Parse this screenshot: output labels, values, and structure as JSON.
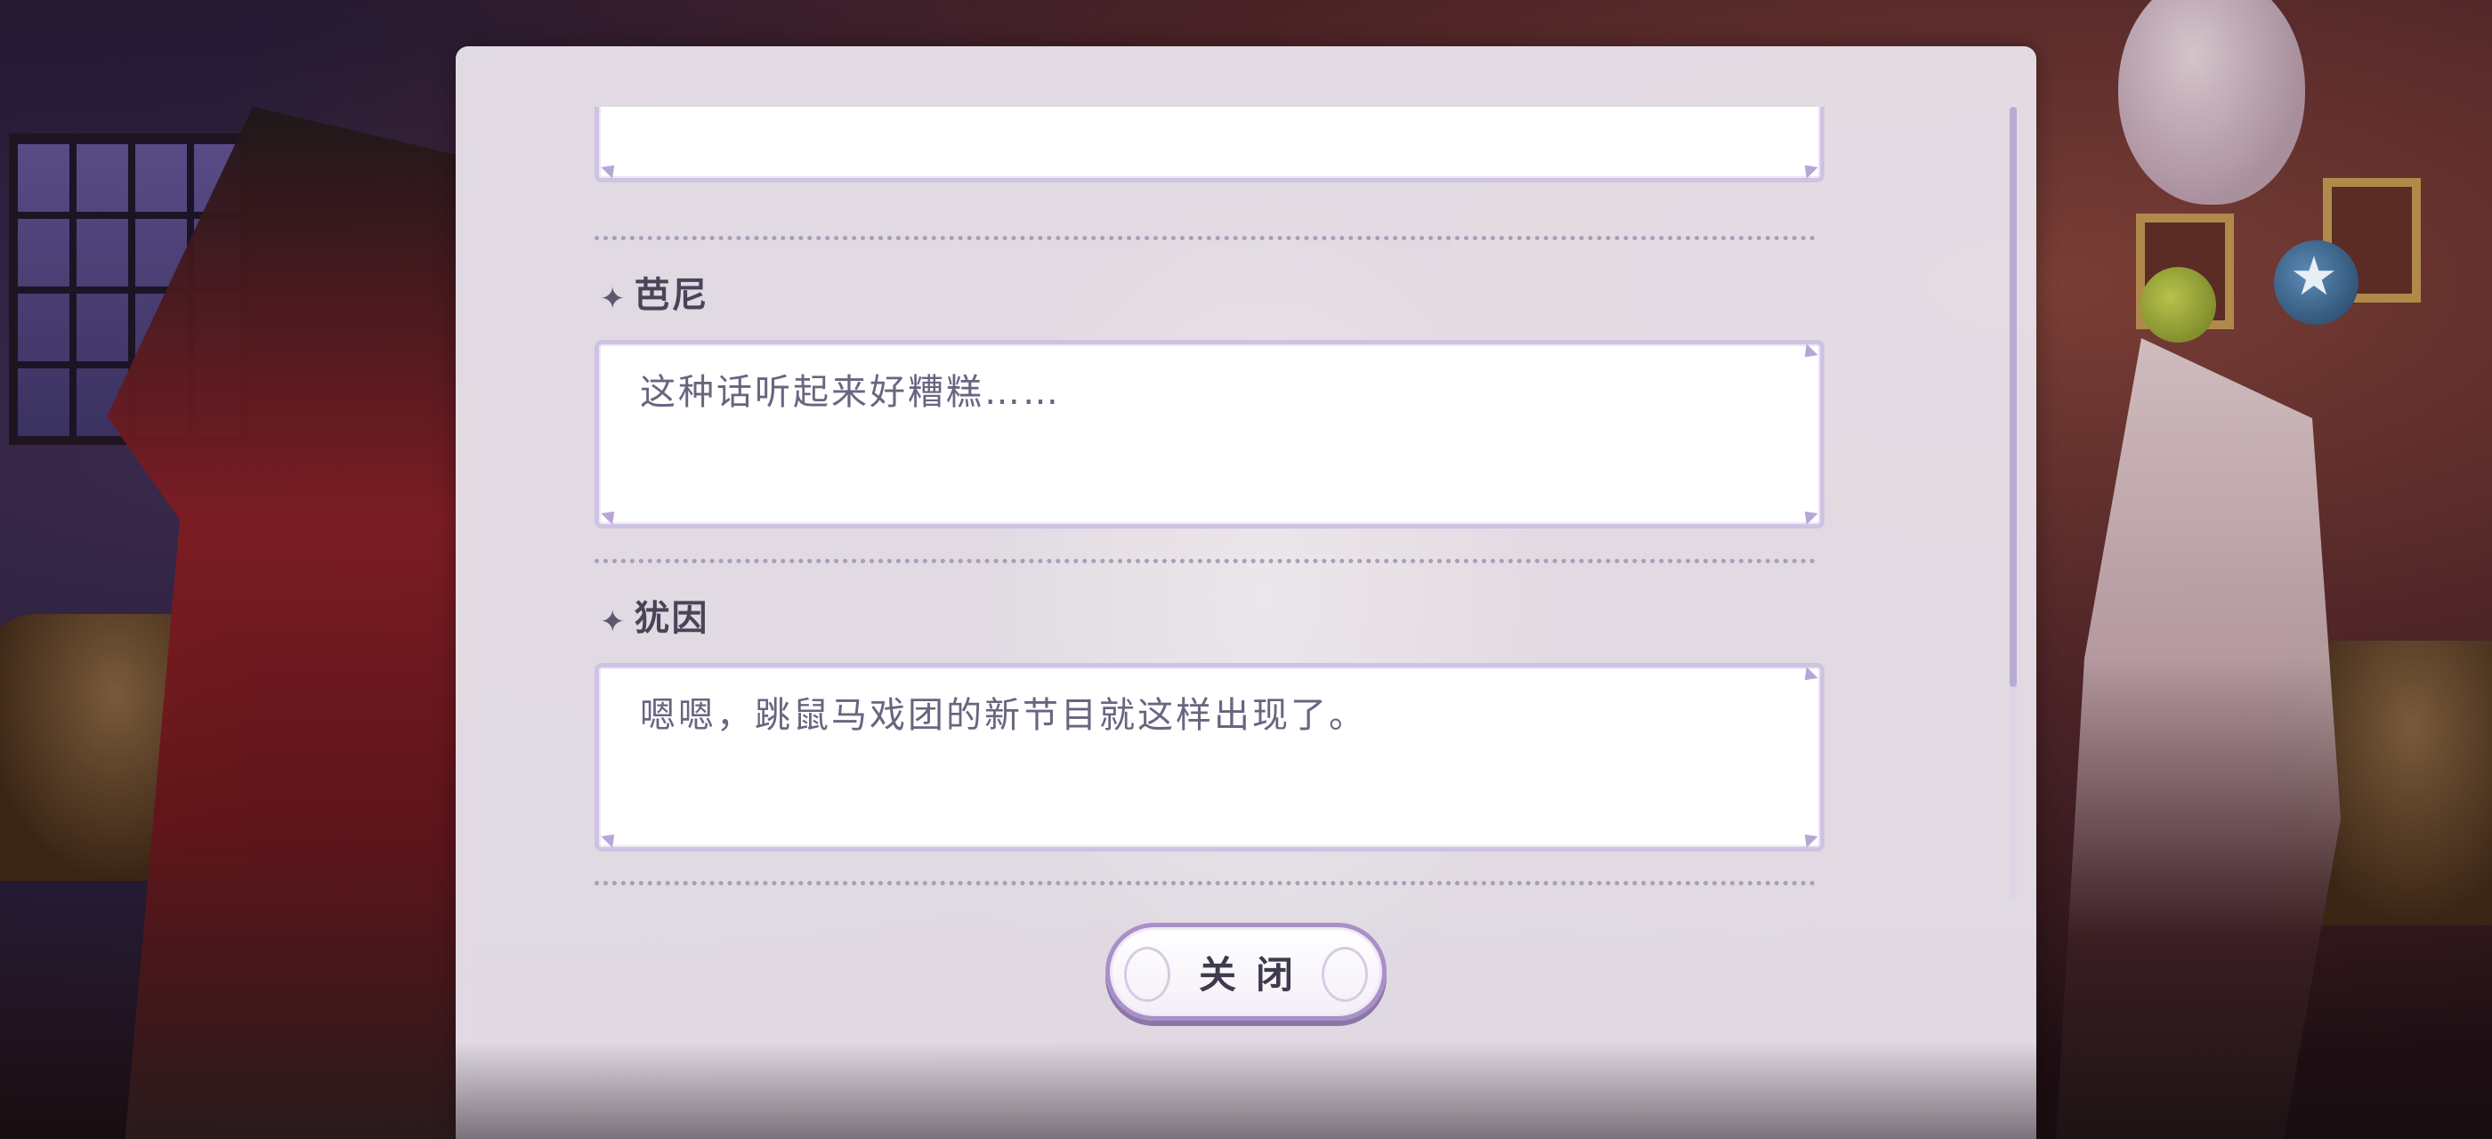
{
  "dialog_log": {
    "entries": [
      {
        "speaker": "",
        "text": ""
      },
      {
        "speaker": "芭尼",
        "text": "这种话听起来好糟糕……"
      },
      {
        "speaker": "犹因",
        "text": "嗯嗯，跳鼠马戏团的新节目就这样出现了。"
      }
    ],
    "icons": {
      "speaker_marker": "sparkle-icon"
    },
    "scroll_position": 0.73
  },
  "close_button": {
    "label": "关闭"
  },
  "colors": {
    "panel_bg": "#e8e2ea",
    "card_border": "#cfc3e3",
    "name_text": "#4a4458",
    "body_text": "#6b6480",
    "button_border": "#a990c8"
  }
}
